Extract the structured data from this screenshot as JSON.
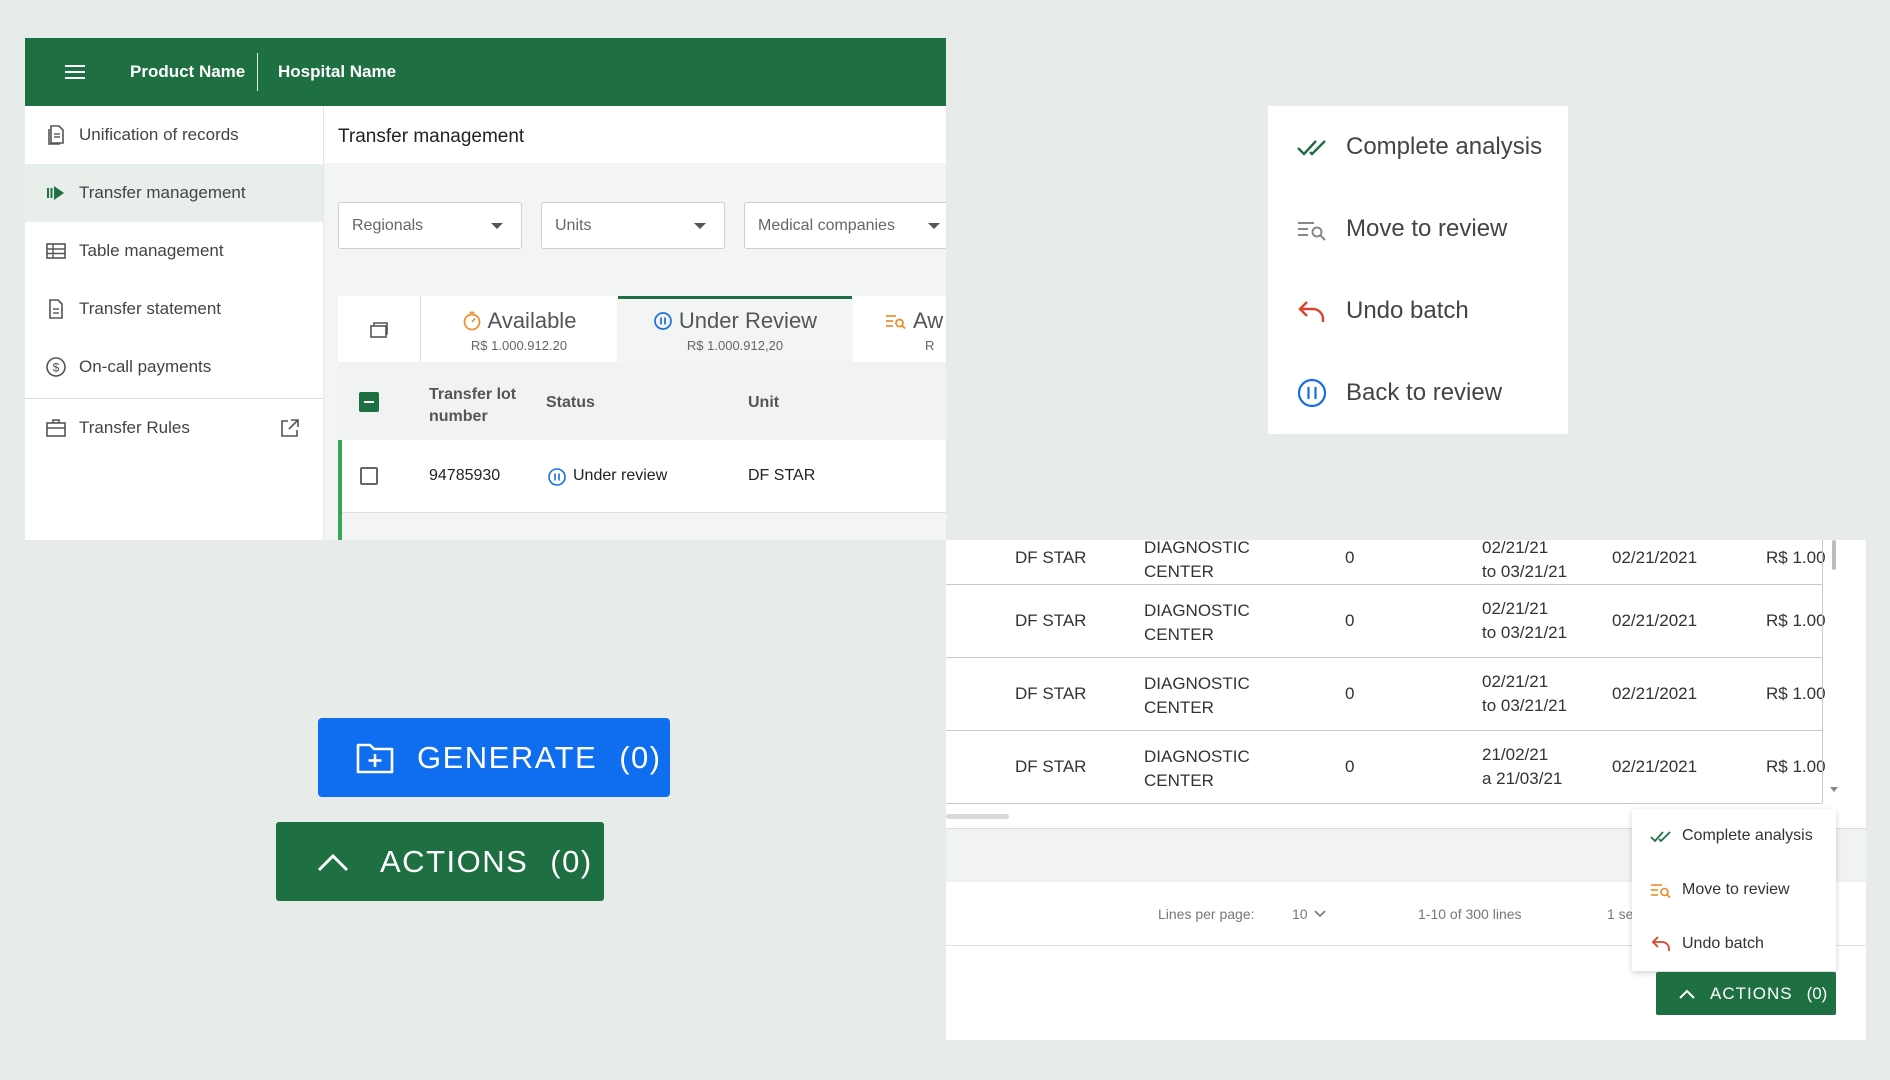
{
  "topbar": {
    "product_name": "Product Name",
    "hospital_name": "Hospital Name"
  },
  "sidebar": {
    "items": [
      {
        "label": "Unification of records",
        "icon": "document-icon"
      },
      {
        "label": "Transfer management",
        "icon": "transfer-icon",
        "active": true
      },
      {
        "label": "Table management",
        "icon": "table-icon"
      },
      {
        "label": "Transfer statement",
        "icon": "statement-icon"
      },
      {
        "label": "On-call payments",
        "icon": "dollar-circle-icon"
      },
      {
        "label": "Transfer Rules",
        "icon": "briefcase-icon",
        "external": true
      }
    ]
  },
  "page": {
    "title": "Transfer management"
  },
  "filters": {
    "regionals": "Regionals",
    "units": "Units",
    "medical_companies": "Medical companies"
  },
  "tabs": [
    {
      "title": "Available",
      "amount": "R$ 1.000.912.20",
      "icon": "timer-icon"
    },
    {
      "title": "Under Review",
      "amount": "R$ 1.000.912,20",
      "icon": "pause-circle-icon",
      "active": true
    },
    {
      "title": "Aw",
      "amount": "R",
      "icon": "review-list-icon"
    }
  ],
  "table": {
    "headers": {
      "lot_number": "Transfer lot number",
      "status": "Status",
      "unit": "Unit"
    },
    "rows": [
      {
        "lot_number": "94785930",
        "status": "Under review",
        "unit": "DF STAR"
      }
    ]
  },
  "menu_large": {
    "items": [
      {
        "label": "Complete analysis",
        "icon": "double-check-icon"
      },
      {
        "label": "Move to review",
        "icon": "review-list-icon"
      },
      {
        "label": "Undo batch",
        "icon": "undo-icon"
      },
      {
        "label": "Back to review",
        "icon": "pause-circle-icon"
      }
    ]
  },
  "detail_table": {
    "rows": [
      {
        "unit": "DF STAR",
        "company_1": "DIAGNOSTIC",
        "company_2": "CENTER",
        "count": "0",
        "period_1": "02/21/21",
        "period_2": "to 03/21/21",
        "date": "02/21/2021",
        "value": "R$ 1.00"
      },
      {
        "unit": "DF STAR",
        "company_1": "DIAGNOSTIC",
        "company_2": "CENTER",
        "count": "0",
        "period_1": "02/21/21",
        "period_2": "to 03/21/21",
        "date": "02/21/2021",
        "value": "R$ 1.00"
      },
      {
        "unit": "DF STAR",
        "company_1": "DIAGNOSTIC",
        "company_2": "CENTER",
        "count": "0",
        "period_1": "02/21/21",
        "period_2": "to 03/21/21",
        "date": "02/21/2021",
        "value": "R$ 1.00"
      },
      {
        "unit": "DF STAR",
        "company_1": "DIAGNOSTIC",
        "company_2": "CENTER",
        "count": "0",
        "period_1": "21/02/21",
        "period_2": "a 21/03/21",
        "date": "02/21/2021",
        "value": "R$ 1.00"
      }
    ]
  },
  "pagination": {
    "lines_per_page_label": "Lines per page:",
    "lines_per_page_value": "10",
    "range": "1-10 of 300 lines",
    "selected": "1 se"
  },
  "menu_small": {
    "items": [
      {
        "label": "Complete analysis",
        "icon": "double-check-icon"
      },
      {
        "label": "Move to review",
        "icon": "review-list-icon"
      },
      {
        "label": "Undo batch",
        "icon": "undo-icon"
      }
    ]
  },
  "buttons": {
    "actions_small_label": "ACTIONS",
    "actions_small_count": "(0)",
    "generate_label": "GENERATE",
    "generate_count": "(0)",
    "actions_big_label": "ACTIONS",
    "actions_big_count": "(0)"
  },
  "colors": {
    "brand_green": "#1e6f41",
    "primary_blue": "#0f6df0",
    "accent_orange": "#f08a24",
    "review_blue": "#1a6fe0",
    "undo_red": "#d9452b"
  }
}
